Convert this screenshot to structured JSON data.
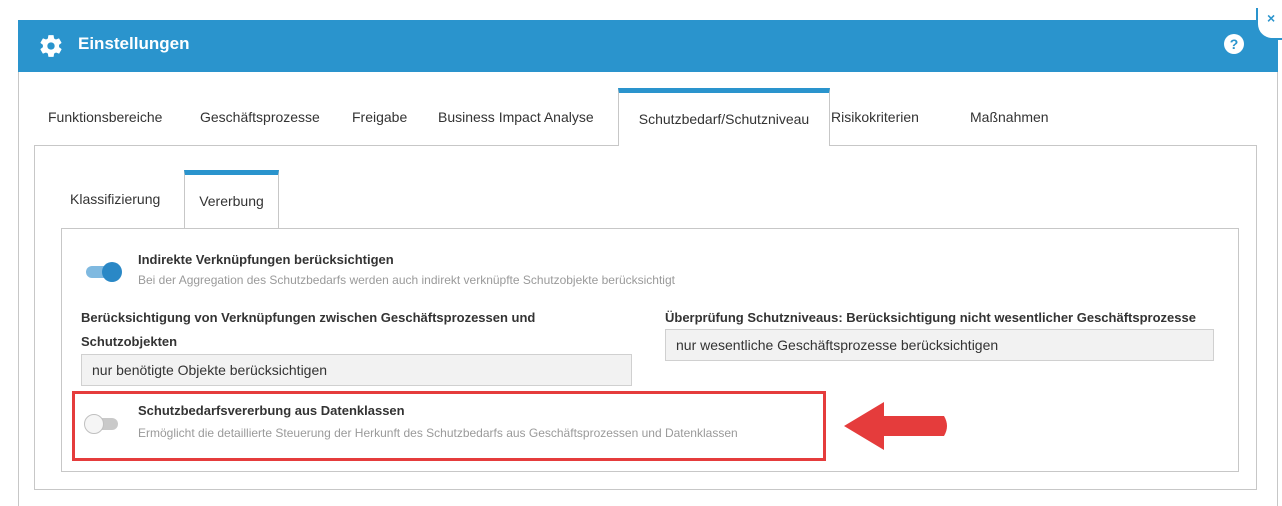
{
  "dialog": {
    "title": "Einstellungen",
    "help_label": "?",
    "close_label": "×",
    "accent_color": "#2a94cd",
    "icons": {
      "settings": "gear-icon",
      "help": "help-icon",
      "close": "close-icon"
    }
  },
  "main_tabs": [
    {
      "label": "Funktionsbereiche",
      "active": false
    },
    {
      "label": "Geschäftsprozesse",
      "active": false
    },
    {
      "label": "Freigabe",
      "active": false
    },
    {
      "label": "Business Impact Analyse",
      "active": false
    },
    {
      "label": "Schutzbedarf/Schutzniveau",
      "active": true
    },
    {
      "label": "Risikokriterien",
      "active": false
    },
    {
      "label": "Maßnahmen",
      "active": false
    }
  ],
  "sub_tabs": [
    {
      "label": "Klassifizierung",
      "active": false
    },
    {
      "label": "Vererbung",
      "active": true
    }
  ],
  "options": {
    "indirect": {
      "title": "Indirekte Verknüpfungen berücksichtigen",
      "description": "Bei der Aggregation des Schutzbedarfs werden auch indirekt verknüpfte Schutzobjekte berücksichtigt",
      "enabled": true
    },
    "inheritance": {
      "title": "Schutzbedarfsvererbung aus Datenklassen",
      "description": "Ermöglicht die detaillierte Steuerung der Herkunft des Schutzbedarfs aus Geschäftsprozessen und Datenklassen",
      "enabled": false
    }
  },
  "fields": {
    "links": {
      "label": "Berücksichtigung von Verknüpfungen zwischen Geschäftsprozessen und Schutzobjekten",
      "value": "nur benötigte Objekte berücksichtigen"
    },
    "review": {
      "label": "Überprüfung Schutzniveaus: Berücksichtigung nicht wesentlicher Geschäftsprozesse",
      "value": "nur wesentliche Geschäftsprozesse berücksichtigen"
    }
  },
  "annotation": {
    "highlight_color": "#e53c3c"
  }
}
